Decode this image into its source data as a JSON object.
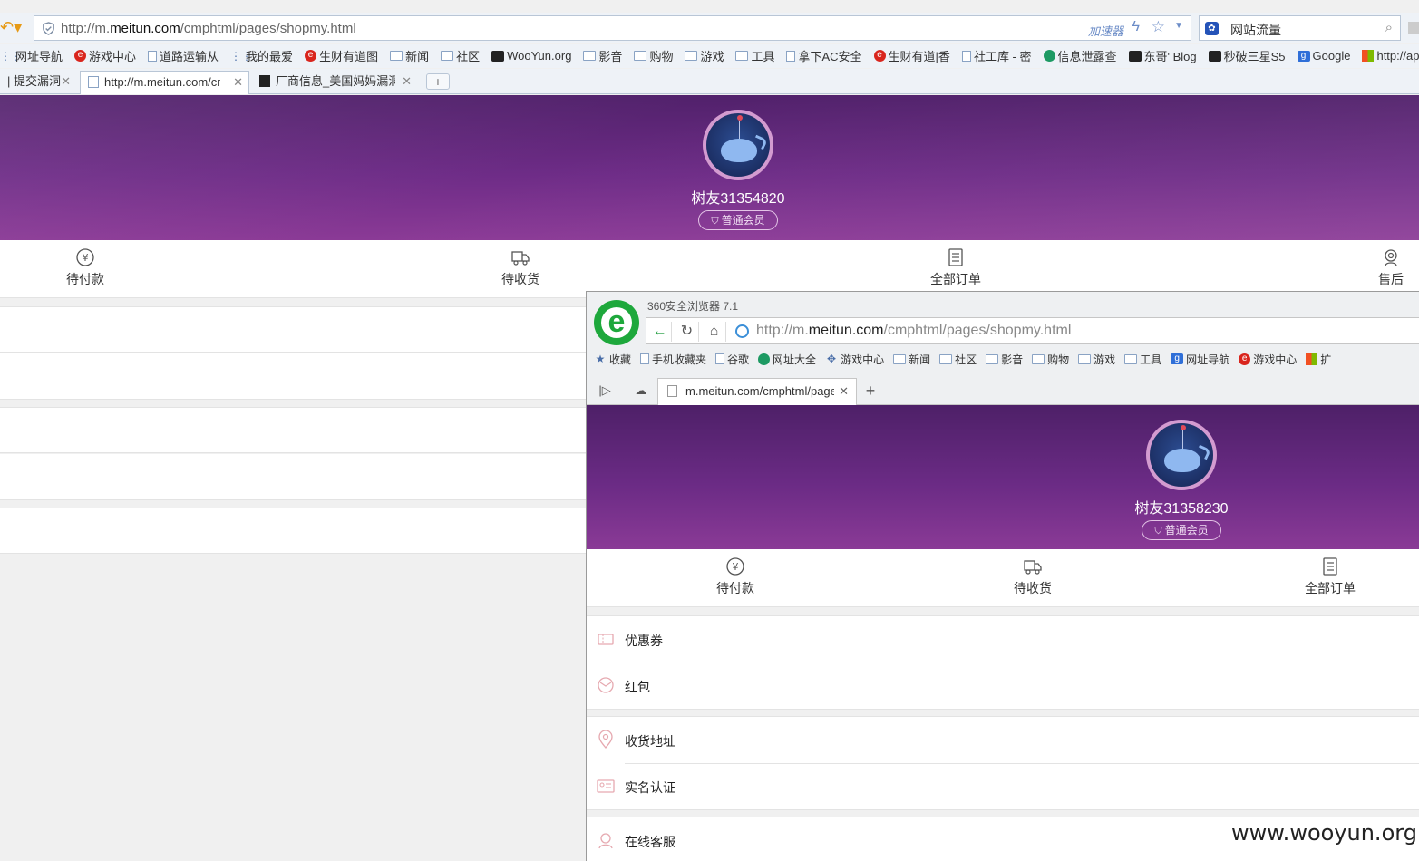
{
  "browser1": {
    "url_prefix": "http://m.",
    "url_domain": "meitun.com",
    "url_path": "/cmphtml/pages/shopmy.html",
    "accelerator_label": "加速器",
    "search_text": "网站流量",
    "bookmarks": [
      {
        "label": "网址导航",
        "icon": "grid-icon"
      },
      {
        "label": "游戏中心",
        "icon": "red-icon"
      },
      {
        "label": "道路运输从",
        "icon": "page-icon"
      },
      {
        "label": "我的最爱",
        "icon": "grid-icon"
      },
      {
        "label": "生财有道图",
        "icon": "red-icon"
      },
      {
        "label": "新闻",
        "icon": "folder-icon"
      },
      {
        "label": "社区",
        "icon": "folder-icon"
      },
      {
        "label": "WooYun.org",
        "icon": "dark-icon"
      },
      {
        "label": "影音",
        "icon": "folder-icon"
      },
      {
        "label": "购物",
        "icon": "folder-icon"
      },
      {
        "label": "游戏",
        "icon": "folder-icon"
      },
      {
        "label": "工具",
        "icon": "folder-icon"
      },
      {
        "label": "拿下AC安全",
        "icon": "page-icon"
      },
      {
        "label": "生财有道|香",
        "icon": "red-icon"
      },
      {
        "label": "社工库 - 密",
        "icon": "page-icon"
      },
      {
        "label": "信息泄露查",
        "icon": "green-icon"
      },
      {
        "label": "东哥' Blog",
        "icon": "dark-icon"
      },
      {
        "label": "秒破三星S5",
        "icon": "dark-icon"
      },
      {
        "label": "Google",
        "icon": "blue-icon"
      },
      {
        "label": "http://app",
        "icon": "ms-icon"
      }
    ],
    "tabs": [
      {
        "label": "| 提交漏洞"
      },
      {
        "label": "http://m.meitun.com/cmphtml/pages/shopmy.html"
      },
      {
        "label": "厂商信息_美国妈妈漏洞列表"
      }
    ]
  },
  "page1": {
    "username": "树友31354820",
    "badge": "普通会员",
    "nav": [
      {
        "label": "待付款",
        "icon": "yen-icon"
      },
      {
        "label": "待收货",
        "icon": "truck-icon"
      },
      {
        "label": "全部订单",
        "icon": "list-icon"
      },
      {
        "label": "售后",
        "icon": "service-icon"
      }
    ]
  },
  "browser2": {
    "app_name": "360安全浏览器 7.1",
    "url_prefix": "http://m.",
    "url_domain": "meitun.com",
    "url_path": "/cmphtml/pages/shopmy.html",
    "bookmarks": [
      {
        "label": "收藏",
        "icon": "star-icon"
      },
      {
        "label": "手机收藏夹",
        "icon": "page-icon"
      },
      {
        "label": "谷歌",
        "icon": "page-icon"
      },
      {
        "label": "网址大全",
        "icon": "green-icon"
      },
      {
        "label": "游戏中心",
        "icon": "gamepad-icon"
      },
      {
        "label": "新闻",
        "icon": "folder-icon"
      },
      {
        "label": "社区",
        "icon": "folder-icon"
      },
      {
        "label": "影音",
        "icon": "folder-icon"
      },
      {
        "label": "购物",
        "icon": "folder-icon"
      },
      {
        "label": "游戏",
        "icon": "folder-icon"
      },
      {
        "label": "工具",
        "icon": "folder-icon"
      },
      {
        "label": "网址导航",
        "icon": "blue-icon"
      },
      {
        "label": "游戏中心",
        "icon": "red-icon"
      },
      {
        "label": "扩",
        "icon": "ms-icon"
      }
    ],
    "tab_label": "m.meitun.com/cmphtml/pages/shopmy.html"
  },
  "page2": {
    "username": "树友31358230",
    "badge": "普通会员",
    "nav": [
      {
        "label": "待付款",
        "icon": "yen-icon"
      },
      {
        "label": "待收货",
        "icon": "truck-icon"
      },
      {
        "label": "全部订单",
        "icon": "list-icon"
      }
    ],
    "menu_groups": [
      [
        {
          "label": "优惠券",
          "icon": "coupon-icon"
        },
        {
          "label": "红包",
          "icon": "redpacket-icon"
        }
      ],
      [
        {
          "label": "收货地址",
          "icon": "location-icon"
        },
        {
          "label": "实名认证",
          "icon": "id-card-icon"
        }
      ],
      [
        {
          "label": "在线客服",
          "icon": "customer-service-icon"
        }
      ]
    ]
  },
  "watermark": "www.wooyun.org",
  "colors": {
    "header_purple": "#6e2c87",
    "badge_border": "#e3c4e6",
    "menu_icon": "#e6a9b0",
    "accent_green": "#1ea83c"
  }
}
